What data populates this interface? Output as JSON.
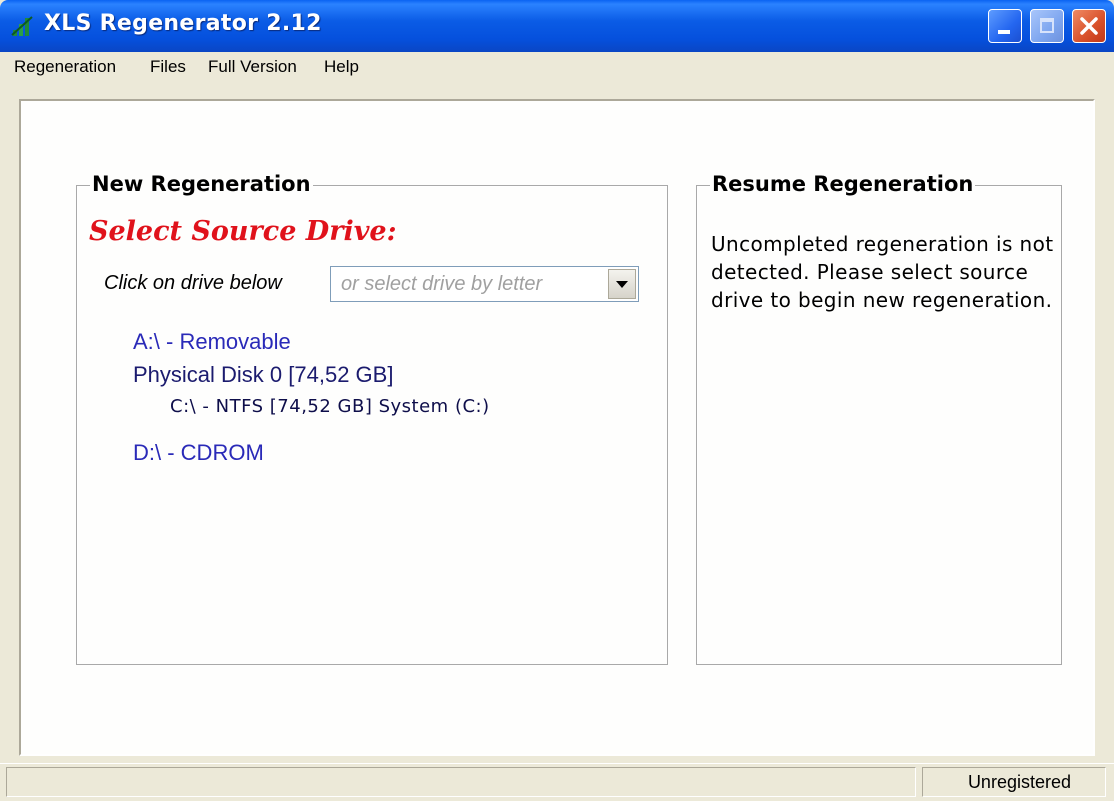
{
  "window": {
    "title": "XLS Regenerator 2.12",
    "accent": "#0a5ce6"
  },
  "menu": {
    "items": [
      "Regeneration",
      "Files",
      "Full Version",
      "Help"
    ]
  },
  "new_regeneration": {
    "group_title": "New Regeneration",
    "heading": "Select Source Drive:",
    "heading_color": "#e0121b",
    "click_label": "Click on drive below",
    "combo_placeholder": "or select drive by letter",
    "drives": {
      "a": "A:\\ - Removable",
      "disk0": "Physical Disk 0  [74,52 GB]",
      "c": "C:\\ - NTFS  [74,52 GB]  System (C:)",
      "d": "D:\\ - CDROM"
    }
  },
  "resume_regeneration": {
    "group_title": "Resume Regeneration",
    "message": "Uncompleted regeneration is not detected. Please select source drive to begin new regeneration."
  },
  "status": {
    "right_text": "Unregistered"
  }
}
